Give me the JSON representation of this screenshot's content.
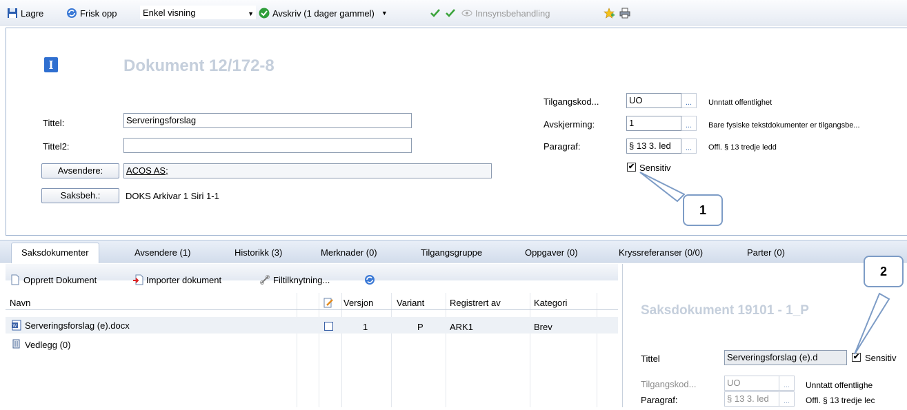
{
  "toolbar": {
    "save_label": "Lagre",
    "refresh_label": "Frisk opp",
    "view_select_value": "Enkel visning",
    "close_label": "Avskriv (1 dager gammel)",
    "access_label": "Innsynsbehandling"
  },
  "document": {
    "title": "Dokument 12/172-8",
    "tittel_label": "Tittel:",
    "tittel_value": "Serveringsforslag",
    "tittel2_label": "Tittel2:",
    "tittel2_value": "",
    "avsendere_button": "Avsendere:",
    "avsendere_value": "ACOS AS;",
    "saksbeh_button": "Saksbeh.:",
    "saksbeh_value": "DOKS Arkivar 1 Siri 1-1",
    "tilgangskode_label": "Tilgangskod...",
    "tilgangskode_value": "UO",
    "tilgangskode_desc": "Unntatt offentlighet",
    "avskjerming_label": "Avskjerming:",
    "avskjerming_value": "1",
    "avskjerming_desc": "Bare fysiske tekstdokumenter er tilgangsbe...",
    "paragraf_label": "Paragraf:",
    "paragraf_value": "§ 13 3. led",
    "paragraf_desc": "Offl. § 13 tredje ledd",
    "sensitiv_label": "Sensitiv",
    "callout1": "1",
    "dots": "..."
  },
  "tabs": [
    {
      "label": "Saksdokumenter"
    },
    {
      "label": "Avsendere (1)"
    },
    {
      "label": "Historikk (3)"
    },
    {
      "label": "Merknader (0)"
    },
    {
      "label": "Tilgangsgruppe"
    },
    {
      "label": "Oppgaver (0)"
    },
    {
      "label": "Kryssreferanser (0/0)"
    },
    {
      "label": "Parter (0)"
    }
  ],
  "doc_toolbar": {
    "create_label": "Opprett Dokument",
    "import_label": "Importer dokument",
    "link_label": "Filtilknytning..."
  },
  "grid": {
    "headers": {
      "name": "Navn",
      "version": "Versjon",
      "variant": "Variant",
      "registered_by": "Registrert av",
      "category": "Kategori"
    },
    "rows": [
      {
        "name": "Serveringsforslag (e).docx",
        "version": "1",
        "variant": "P",
        "registered_by": "ARK1",
        "category": "Brev"
      },
      {
        "name": "Vedlegg (0)"
      }
    ]
  },
  "saksdokument": {
    "title": "Saksdokument 19101 - 1_P",
    "tittel_label": "Tittel",
    "tittel_value": "Serveringsforslag (e).d",
    "sensitiv_label": "Sensitiv",
    "tilgangskode_label": "Tilgangskod...",
    "tilgangskode_value": "UO",
    "tilgangskode_desc": "Unntatt offentlighe",
    "paragraf_label": "Paragraf:",
    "paragraf_value": "§ 13 3. led",
    "paragraf_desc": "Offl. § 13 tredje lec",
    "callout2": "2"
  }
}
